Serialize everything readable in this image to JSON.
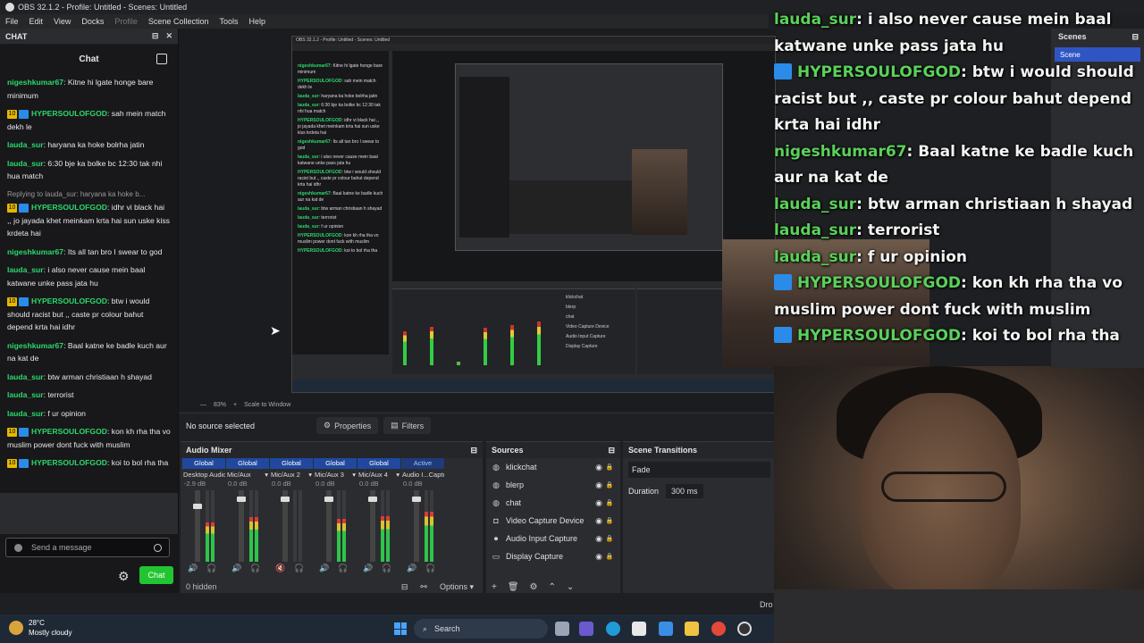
{
  "window": {
    "title": "OBS 32.1.2 - Profile: Untitled - Scenes: Untitled"
  },
  "menu": [
    "File",
    "Edit",
    "View",
    "Docks",
    "Profile",
    "Scene Collection",
    "Tools",
    "Help"
  ],
  "chat_dock": {
    "dock_title": "CHAT",
    "header": "Chat",
    "messages": [
      {
        "user": "nigeshkumar67",
        "text": "Kitne hi lgate honge bare minimum",
        "badges": false
      },
      {
        "user": "HYPERSOULOFGOD",
        "text": "sah mein match dekh le",
        "badges": true
      },
      {
        "user": "lauda_sur",
        "text": "haryana ka hoke bolrha jatin",
        "badges": false
      },
      {
        "user": "lauda_sur",
        "text": "6:30 bje ka bolke bc 12:30 tak nhi hua match",
        "badges": false
      },
      {
        "user": "HYPERSOULOFGOD",
        "text": "idhr vi black hai ,, jo jayada khet meinkam krta hai sun uske kiss krdeta hai",
        "badges": true,
        "reply": "Replying to lauda_sur: haryana ka hoke b..."
      },
      {
        "user": "nigeshkumar67",
        "text": "Its all tan bro I swear to god",
        "badges": false
      },
      {
        "user": "lauda_sur",
        "text": "i also never cause mein baal katwane unke pass jata hu",
        "badges": false
      },
      {
        "user": "HYPERSOULOFGOD",
        "text": "btw i would should racist but ,, caste pr colour bahut depend krta hai idhr",
        "badges": true
      },
      {
        "user": "nigeshkumar67",
        "text": "Baal katne ke badle kuch aur na kat de",
        "badges": false
      },
      {
        "user": "lauda_sur",
        "text": "btw arman christiaan h shayad",
        "badges": false
      },
      {
        "user": "lauda_sur",
        "text": "terrorist",
        "badges": false
      },
      {
        "user": "lauda_sur",
        "text": "f ur opinion",
        "badges": false
      },
      {
        "user": "HYPERSOULOFGOD",
        "text": "kon kh rha tha vo muslim power dont fuck with muslim",
        "badges": true
      },
      {
        "user": "HYPERSOULOFGOD",
        "text": "koi to bol rha tha",
        "badges": true
      }
    ],
    "badge_number": "10",
    "input_placeholder": "Send a message",
    "send_label": "Chat"
  },
  "preview_bar": {
    "zoom": "83%",
    "scale": "Scale to Window"
  },
  "source_toolbar": {
    "no_source": "No source selected",
    "properties": "Properties",
    "filters": "Filters"
  },
  "audio_mixer": {
    "title": "Audio Mixer",
    "channels": [
      {
        "global": "Global",
        "name": "Desktop Audio",
        "db": "-2.9 dB",
        "level": 0.55,
        "fader": 0.8,
        "muted": false
      },
      {
        "global": "Global",
        "name": "Mic/Aux",
        "db": "0.0 dB",
        "level": 0.62,
        "fader": 0.9,
        "muted": false
      },
      {
        "global": "Global",
        "name": "Mic/Aux 2",
        "db": "0.0 dB",
        "level": 0.0,
        "fader": 0.9,
        "muted": true
      },
      {
        "global": "Global",
        "name": "Mic/Aux 3",
        "db": "0.0 dB",
        "level": 0.6,
        "fader": 0.9,
        "muted": false
      },
      {
        "global": "Global",
        "name": "Mic/Aux 4",
        "db": "0.0 dB",
        "level": 0.64,
        "fader": 0.9,
        "muted": false
      },
      {
        "global": "Active",
        "name": "Audio I...Capture",
        "db": "0.0 dB",
        "level": 0.7,
        "fader": 0.9,
        "muted": false
      }
    ],
    "ticks": [
      "0",
      "-5",
      "-10",
      "-15",
      "-20",
      "-25",
      "-30",
      "-35",
      "-40",
      "-45",
      "-50",
      "-55",
      "-60"
    ],
    "hidden": "0 hidden",
    "options": "Options"
  },
  "sources": {
    "title": "Sources",
    "items": [
      {
        "name": "klickchat",
        "icon": "globe-icon"
      },
      {
        "name": "blerp",
        "icon": "globe-icon"
      },
      {
        "name": "chat",
        "icon": "globe-icon"
      },
      {
        "name": "Video Capture Device",
        "icon": "camera-icon"
      },
      {
        "name": "Audio Input Capture",
        "icon": "mic-icon"
      },
      {
        "name": "Display Capture",
        "icon": "monitor-icon"
      }
    ]
  },
  "transitions": {
    "title": "Scene Transitions",
    "type": "Fade",
    "duration_label": "Duration",
    "duration": "300 ms"
  },
  "scenes": {
    "title": "Scenes",
    "selected": "Scene"
  },
  "overlay_chat": [
    {
      "user": "lauda_sur",
      "text": "i also never cause mein baal katwane unke pass jata hu",
      "badge": false
    },
    {
      "user": "HYPERSOULOFGOD",
      "text": "btw i would should racist but ,, caste pr colour bahut depend krta hai idhr",
      "badge": true
    },
    {
      "user": "nigeshkumar67",
      "text": "Baal katne ke badle kuch aur na kat de",
      "badge": false
    },
    {
      "user": "lauda_sur",
      "text": "btw arman christiaan h shayad",
      "badge": false
    },
    {
      "user": "lauda_sur",
      "text": "terrorist",
      "badge": false
    },
    {
      "user": "lauda_sur",
      "text": "f ur opinion",
      "badge": false
    },
    {
      "user": "HYPERSOULOFGOD",
      "text": "kon kh rha tha vo muslim power dont fuck with muslim",
      "badge": true
    },
    {
      "user": "HYPERSOULOFGOD",
      "text": "koi to bol rha tha",
      "badge": true
    }
  ],
  "taskbar": {
    "temp": "28°C",
    "weather": "Mostly cloudy",
    "search": "Search",
    "dock_cut": "Dro"
  },
  "colors": {
    "chat_user_green": "#2bd96b",
    "chat_button": "#22c531",
    "selected_scene": "#2f55c4",
    "badge_blue": "#2a8be8"
  }
}
